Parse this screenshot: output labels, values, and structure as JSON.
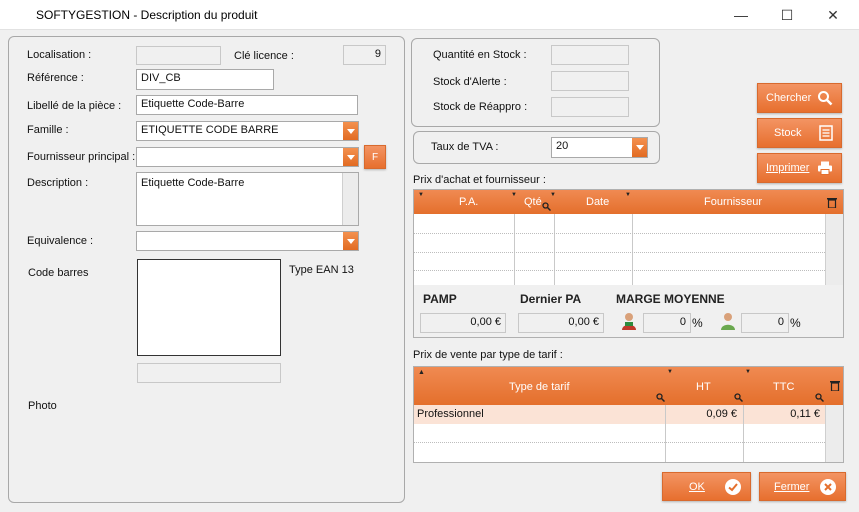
{
  "window": {
    "title": "SOFTYGESTION - Description du produit",
    "minimize_glyph": "—",
    "maximize_glyph": "☐",
    "close_glyph": "✕"
  },
  "left": {
    "localisation_label": "Localisation :",
    "localisation_value": "",
    "cle_licence_label": "Clé licence :",
    "cle_licence_value": "9",
    "reference_label": "Référence :",
    "reference_value": "DIV_CB",
    "libelle_label": "Libellé de la pièce :",
    "libelle_value": "Etiquette Code-Barre",
    "famille_label": "Famille :",
    "famille_value": "ETIQUETTE CODE BARRE",
    "fournisseur_label": "Fournisseur principal :",
    "fournisseur_value": "",
    "fournisseur_btn": "F",
    "description_label": "Description :",
    "description_value": "Etiquette Code-Barre",
    "equivalence_label": "Equivalence :",
    "equivalence_value": "",
    "code_barres_label": "Code barres",
    "type_ean_label": "Type EAN 13",
    "code_barres_value": "",
    "photo_label": "Photo"
  },
  "stock": {
    "quantite_label": "Quantité en Stock :",
    "alerte_label": "Stock d'Alerte :",
    "reappro_label": "Stock de Réappro :",
    "quantite_value": "",
    "alerte_value": "",
    "reappro_value": ""
  },
  "tva": {
    "label": "Taux de TVA :",
    "value": "20"
  },
  "buttons": {
    "chercher": "Chercher",
    "stock": "Stock",
    "imprimer": "Imprimer",
    "ok": "OK",
    "fermer": "Fermer"
  },
  "achat": {
    "section_label": "Prix d'achat et fournisseur :",
    "columns": [
      "P.A.",
      "Qté",
      "Date",
      "Fournisseur"
    ],
    "pamp_label": "PAMP",
    "dernier_pa_label": "Dernier PA",
    "marge_label": "MARGE MOYENNE",
    "pamp_value": "0,00 €",
    "dernier_pa_value": "0,00 €",
    "marge1_value": "0",
    "marge2_value": "0",
    "percent": "%"
  },
  "vente": {
    "section_label": "Prix de vente par type de tarif :",
    "columns": [
      "Type de tarif",
      "HT",
      "TTC"
    ],
    "rows": [
      {
        "type": "Professionnel",
        "ht": "0,09 €",
        "ttc": "0,11 €"
      }
    ]
  },
  "colors": {
    "accent": "#e8772f",
    "selected_row": "#fbe3d6"
  }
}
